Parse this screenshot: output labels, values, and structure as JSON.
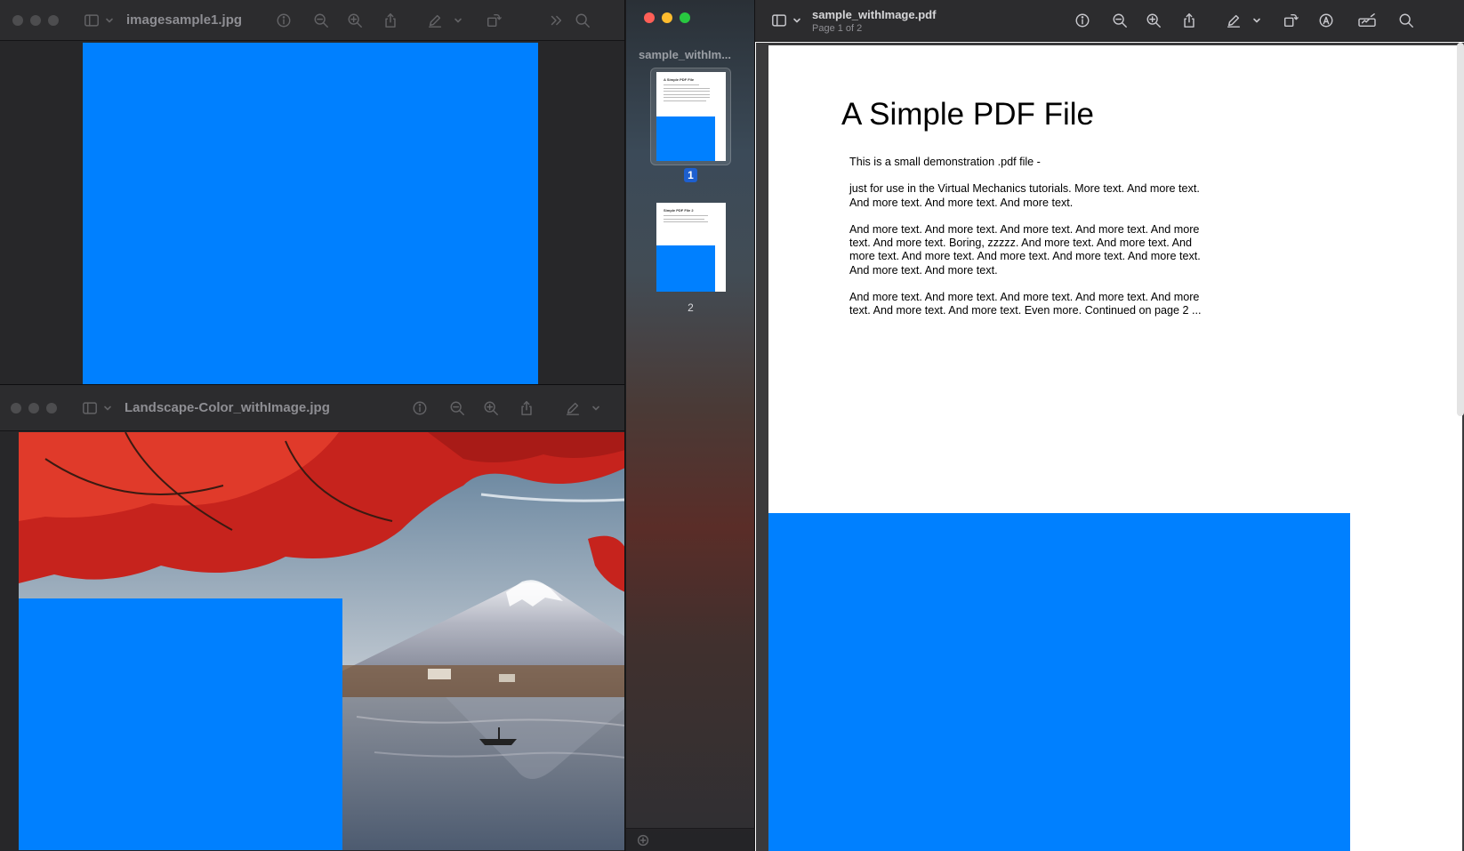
{
  "colors": {
    "blue_block": "#0080ff",
    "accent": "#1d5fcf"
  },
  "window_a": {
    "title": "imagesample1.jpg",
    "icons": [
      "sidebar-icon",
      "chevron-down-icon",
      "info-icon",
      "zoom-out-icon",
      "zoom-in-icon",
      "share-icon",
      "markup-icon",
      "chevron-down-icon",
      "rotate-icon",
      "overflow-icon",
      "search-icon"
    ]
  },
  "window_b": {
    "title": "Landscape-Color_withImage.jpg",
    "icons": [
      "sidebar-icon",
      "chevron-down-icon",
      "info-icon",
      "zoom-out-icon",
      "zoom-in-icon",
      "share-icon",
      "markup-icon",
      "chevron-down-icon"
    ]
  },
  "window_c": {
    "sidebar_title": "sample_withIm...",
    "thumbnails": [
      {
        "page": "1",
        "heading": "A Simple PDF File",
        "selected": true
      },
      {
        "page": "2",
        "heading": "Simple PDF File 2",
        "selected": false
      }
    ],
    "doc_name": "sample_withImage.pdf",
    "doc_page": "Page 1 of 2",
    "icons": [
      "sidebar-icon",
      "chevron-down-icon",
      "info-icon",
      "zoom-out-icon",
      "zoom-in-icon",
      "share-icon",
      "markup-icon",
      "chevron-down-icon",
      "rotate-icon",
      "annotate-icon",
      "signature-icon",
      "search-icon",
      "add-icon"
    ],
    "pdf": {
      "heading": "A Simple PDF File",
      "paragraphs": [
        "This is a small demonstration .pdf file -",
        "just for use in the Virtual Mechanics tutorials. More text. And more text. And more text. And more text. And more text.",
        "And more text. And more text. And more text. And more text. And more text. And more text. Boring, zzzzz. And more text. And more text. And more text. And more text. And more text. And more text. And more text. And more text. And more text.",
        "And more text. And more text. And more text. And more text. And more text. And more text. And more text. Even more. Continued on page 2 ..."
      ]
    }
  }
}
